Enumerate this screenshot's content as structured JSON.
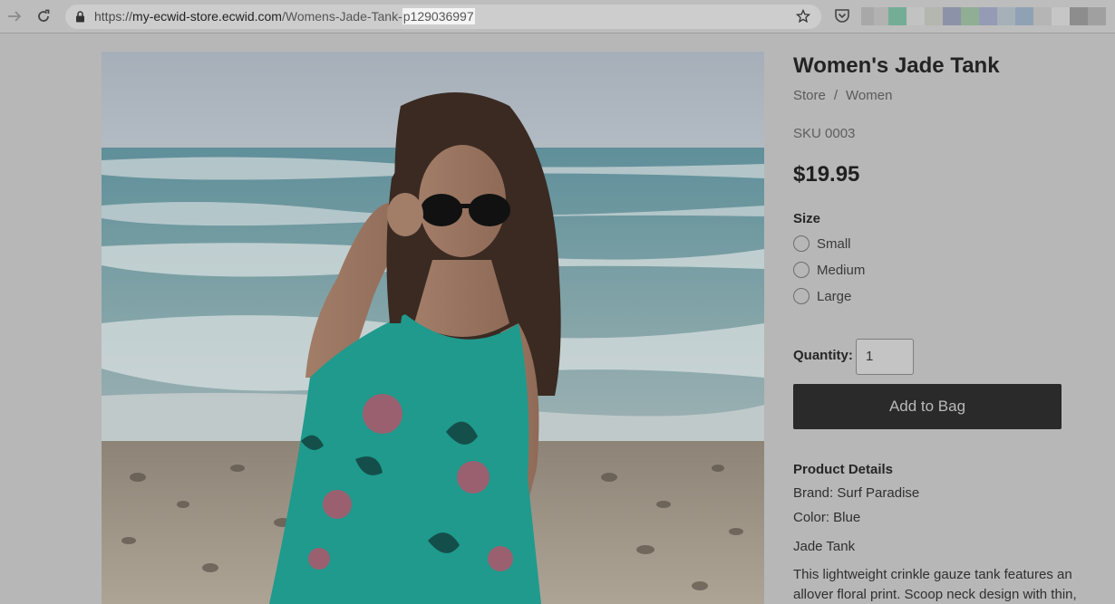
{
  "browser": {
    "url_scheme": "https://",
    "url_host": "my-ecwid-store.ecwid.com",
    "url_path": "/Womens-Jade-Tank-",
    "url_selected": "p129036997",
    "icons": [
      "forward-arrow-icon",
      "reload-icon",
      "lock-icon",
      "star-icon",
      "pocket-icon"
    ]
  },
  "product": {
    "title": "Women's Jade Tank",
    "breadcrumb": [
      "Store",
      "Women"
    ],
    "breadcrumb_sep": "/",
    "sku": "SKU 0003",
    "price": "$19.95",
    "size_label": "Size",
    "sizes": [
      "Small",
      "Medium",
      "Large"
    ],
    "quantity_label": "Quantity:",
    "quantity_value": "1",
    "add_button": "Add to Bag",
    "details_heading": "Product Details",
    "brand": "Brand: Surf Paradise",
    "color": "Color: Blue",
    "name_line": "Jade Tank",
    "description": "This lightweight crinkle gauze tank features an allover floral print. Scoop neck design with thin,"
  },
  "colors": {
    "overlay_bg": "#b7b7b7",
    "button_bg": "#2a2a2a",
    "shirt": "#1fa89a"
  }
}
